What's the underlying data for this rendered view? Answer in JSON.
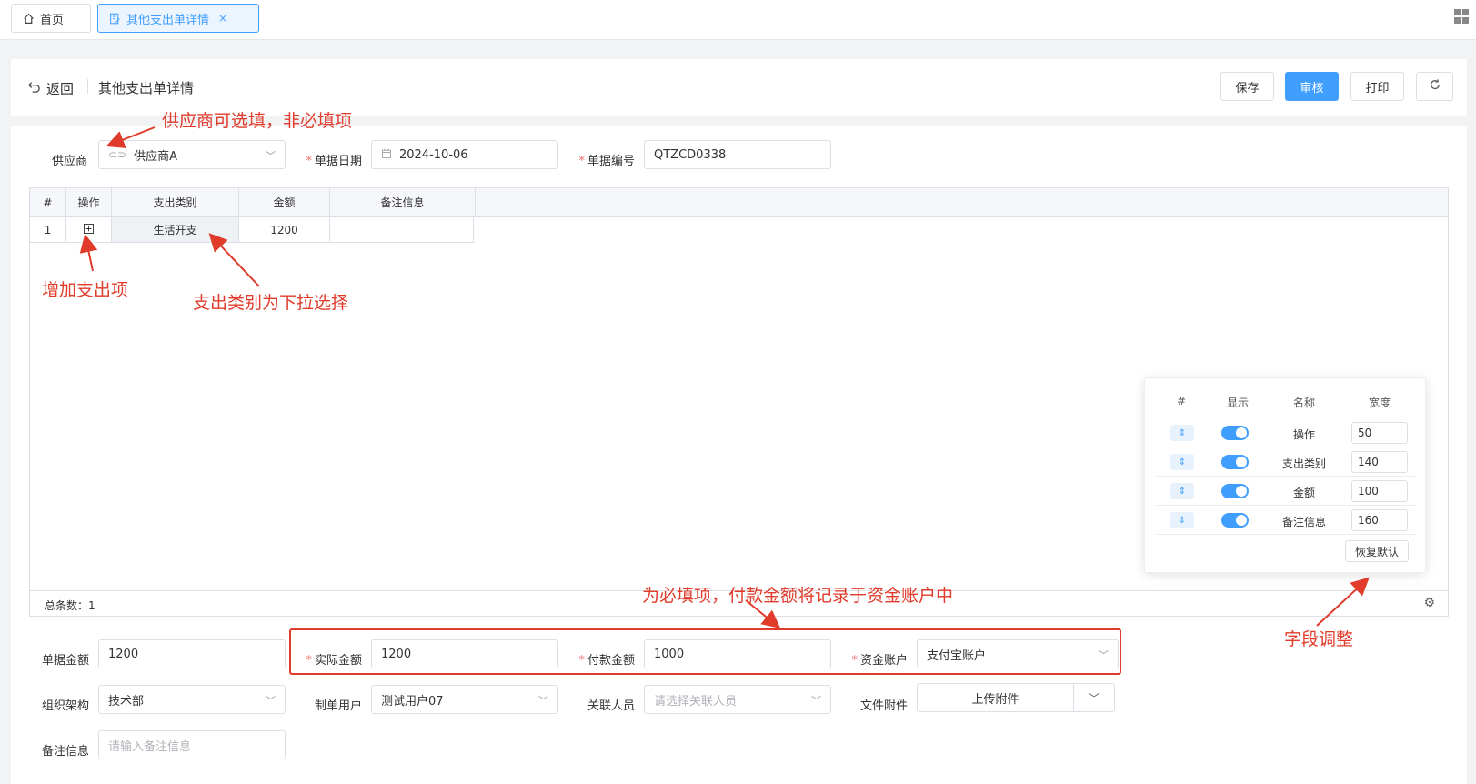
{
  "tabs": {
    "home_label": "首页",
    "active_label": "其他支出单详情",
    "close_glyph": "×"
  },
  "header": {
    "back_label": "返回",
    "title": "其他支出单详情",
    "save_label": "保存",
    "audit_label": "审核",
    "print_label": "打印"
  },
  "form": {
    "supplier": {
      "label": "供应商",
      "value": "供应商A"
    },
    "date": {
      "label": "单据日期",
      "value": "2024-10-06"
    },
    "doc_no": {
      "label": "单据编号",
      "value": "QTZCD0338"
    },
    "doc_amount": {
      "label": "单据金额",
      "value": "1200"
    },
    "actual_amount": {
      "label": "实际金额",
      "value": "1200"
    },
    "pay_amount": {
      "label": "付款金额",
      "value": "1000"
    },
    "account": {
      "label": "资金账户",
      "value": "支付宝账户"
    },
    "org": {
      "label": "组织架构",
      "value": "技术部"
    },
    "maker": {
      "label": "制单用户",
      "value": "测试用户07"
    },
    "related": {
      "label": "关联人员",
      "placeholder": "请选择关联人员"
    },
    "attachment": {
      "label": "文件附件",
      "button": "上传附件"
    },
    "remark": {
      "label": "备注信息",
      "placeholder": "请输入备注信息"
    }
  },
  "table": {
    "headers": [
      "#",
      "操作",
      "支出类别",
      "金额",
      "备注信息"
    ],
    "rows": [
      {
        "index": "1",
        "category": "生活开支",
        "amount": "1200",
        "remark": ""
      }
    ],
    "total_label": "总条数：1"
  },
  "column_panel": {
    "headers": [
      "#",
      "显示",
      "名称",
      "宽度"
    ],
    "rows": [
      {
        "name": "操作",
        "width": "50"
      },
      {
        "name": "支出类别",
        "width": "140"
      },
      {
        "name": "金额",
        "width": "100"
      },
      {
        "name": "备注信息",
        "width": "160"
      }
    ],
    "reset_label": "恢复默认"
  },
  "annotations": {
    "supplier_note": "供应商可选填，非必填项",
    "add_item_note": "增加支出项",
    "category_note": "支出类别为下拉选择",
    "required_note": "为必填项，付款金额将记录于资金账户中",
    "field_adjust_note": "字段调整"
  },
  "colors": {
    "primary": "#409eff",
    "annotation_red": "#e03b2b",
    "required_star": "#f56c6c"
  }
}
